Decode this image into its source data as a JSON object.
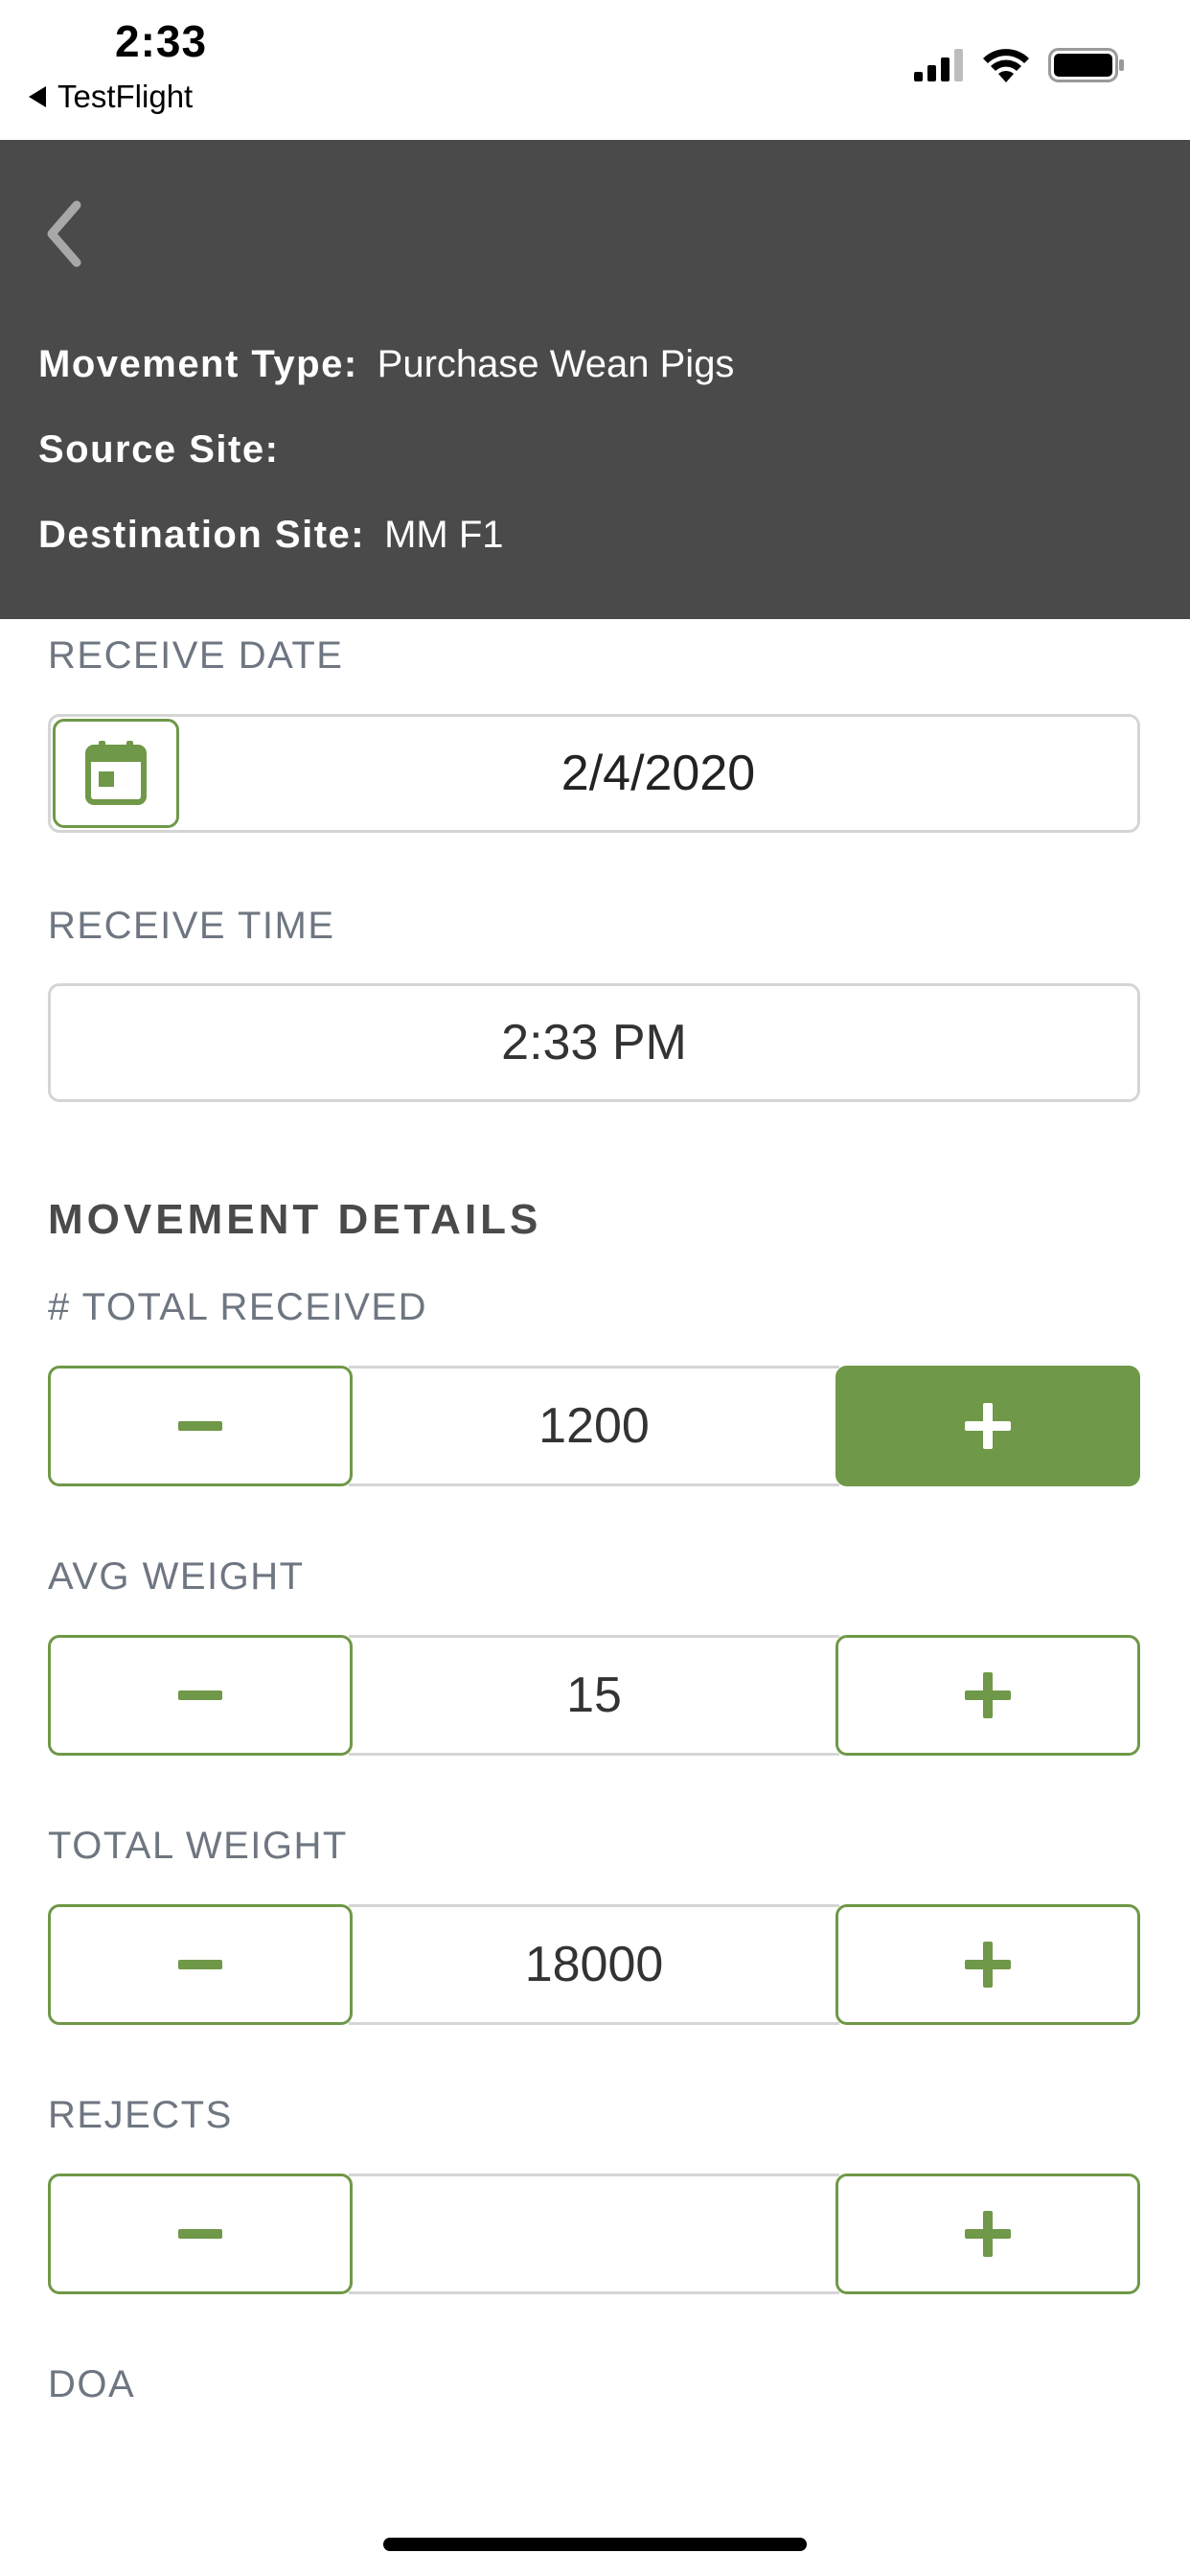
{
  "status_bar": {
    "time": "2:33",
    "back_app": "TestFlight"
  },
  "header": {
    "movement_type_label": "Movement Type:",
    "movement_type_value": "Purchase Wean Pigs",
    "source_site_label": "Source Site:",
    "source_site_value": "",
    "destination_site_label": "Destination Site:",
    "destination_site_value": "MM F1"
  },
  "form": {
    "receive_date_label": "RECEIVE DATE",
    "receive_date_value": "2/4/2020",
    "receive_time_label": "RECEIVE TIME",
    "receive_time_value": "2:33 PM",
    "movement_details_heading": "MOVEMENT DETAILS",
    "steppers": [
      {
        "label": "# TOTAL RECEIVED",
        "value": "1200"
      },
      {
        "label": "AVG WEIGHT",
        "value": "15"
      },
      {
        "label": "TOTAL WEIGHT",
        "value": "18000"
      },
      {
        "label": "REJECTS",
        "value": ""
      },
      {
        "label": "DOA",
        "value": ""
      }
    ]
  },
  "colors": {
    "accent_green": "#6f9848",
    "header_bg": "#4a4a4a"
  }
}
